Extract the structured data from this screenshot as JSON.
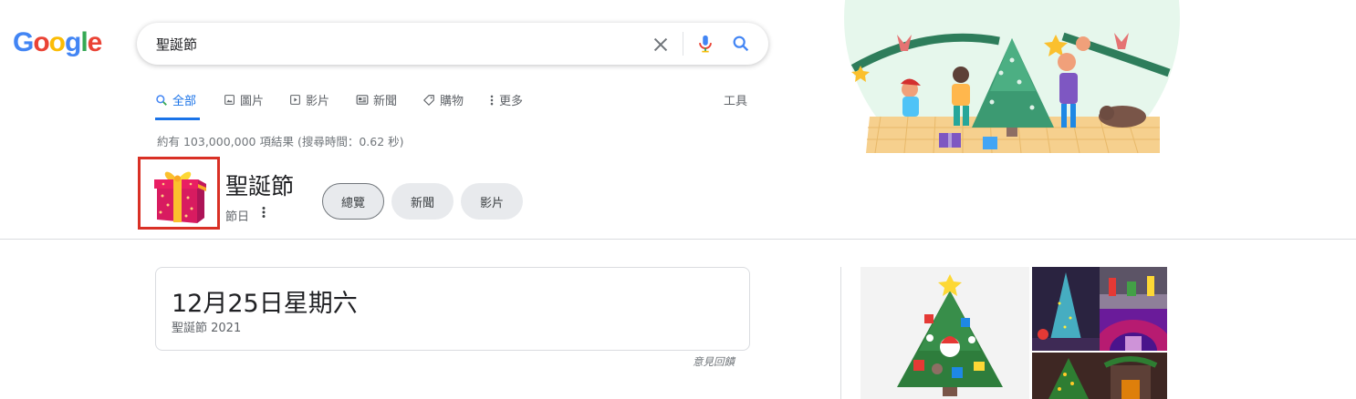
{
  "logo": {
    "letters": [
      "G",
      "o",
      "o",
      "g",
      "l",
      "e"
    ],
    "colors": [
      "#4285f4",
      "#ea4335",
      "#fbbc05",
      "#4285f4",
      "#34a853",
      "#ea4335"
    ]
  },
  "search": {
    "query": "聖誕節"
  },
  "tabs": [
    {
      "label": "全部",
      "icon": "search-icon",
      "active": true
    },
    {
      "label": "圖片",
      "icon": "image-icon"
    },
    {
      "label": "影片",
      "icon": "play-icon"
    },
    {
      "label": "新聞",
      "icon": "news-icon"
    },
    {
      "label": "購物",
      "icon": "tag-icon"
    },
    {
      "label": "更多",
      "icon": "more-vert-icon"
    }
  ],
  "tools_label": "工具",
  "result_stats": "約有 103,000,000 項結果 (搜尋時間：0.62 秒)",
  "entity": {
    "title": "聖誕節",
    "subtitle": "節日",
    "chips": [
      {
        "label": "總覽",
        "selected": true
      },
      {
        "label": "新聞"
      },
      {
        "label": "影片"
      }
    ]
  },
  "date_card": {
    "date": "12月25日星期六",
    "caption": "聖誕節 2021"
  },
  "feedback": "意見回饋",
  "colors": {
    "accent": "#1a73e8",
    "highlight_border": "#d93025"
  }
}
